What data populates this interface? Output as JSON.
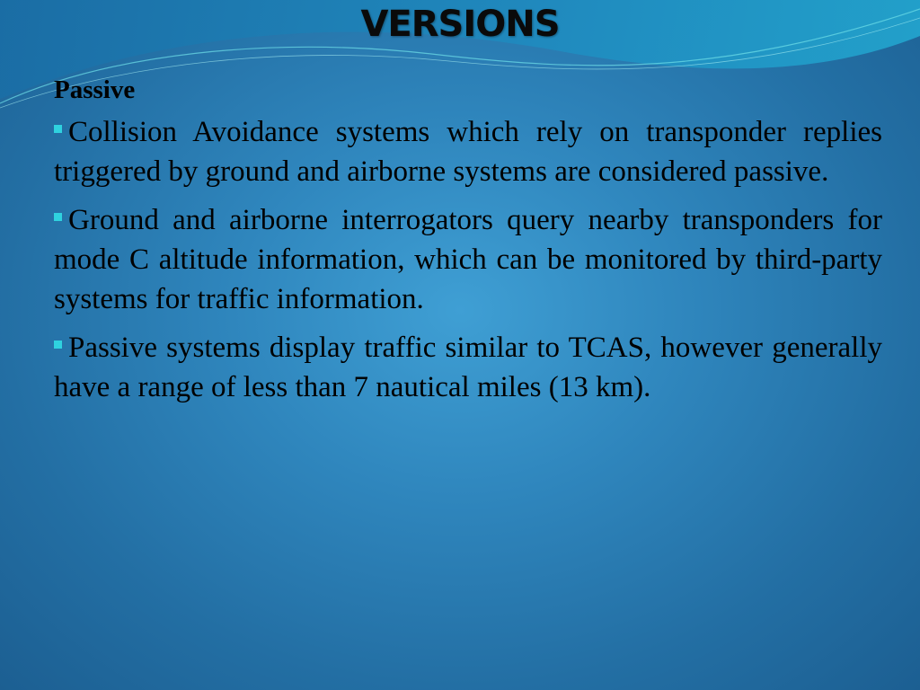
{
  "slide": {
    "title": "VERSIONS",
    "heading": "Passive",
    "bullets": [
      "Collision Avoidance systems which rely on transponder replies triggered by ground and airborne systems are considered passive.",
      "Ground and airborne interrogators query nearby transponders for mode C altitude information, which can be monitored by third-party systems for traffic information.",
      "Passive systems display traffic similar to TCAS, however generally have a range of less than 7 nautical miles (13 km)."
    ],
    "colors": {
      "bullet_marker": "#2fd2df",
      "background": "#2f86bd"
    }
  }
}
